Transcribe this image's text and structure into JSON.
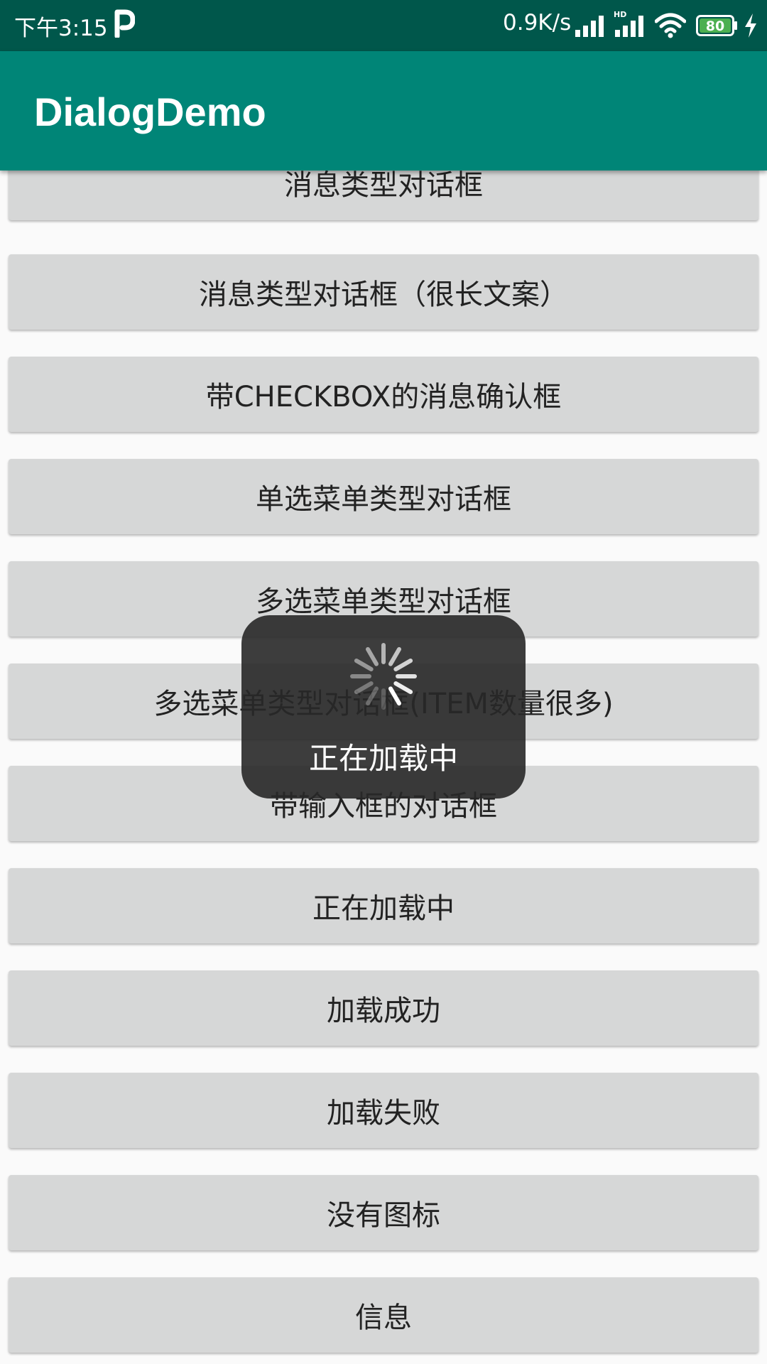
{
  "status_bar": {
    "time": "下午3:15",
    "network_speed": "0.9K/s",
    "battery_level": "80",
    "colors": {
      "background": "#00574b",
      "battery_fill": "#4caf50"
    },
    "icons": [
      "parking-p-icon",
      "signal-icon",
      "hd-signal-icon",
      "wifi-icon",
      "battery-icon",
      "charging-icon"
    ]
  },
  "app_bar": {
    "title": "DialogDemo",
    "color": "#008577"
  },
  "buttons": [
    {
      "label": "消息类型对话框"
    },
    {
      "label": "消息类型对话框（很长文案）"
    },
    {
      "label": "带CHECKBOX的消息确认框"
    },
    {
      "label": "单选菜单类型对话框"
    },
    {
      "label": "多选菜单类型对话框"
    },
    {
      "label": "多选菜单类型对话框(ITEM数量很多)"
    },
    {
      "label": "带输入框的对话框"
    },
    {
      "label": "正在加载中"
    },
    {
      "label": "加载成功"
    },
    {
      "label": "加载失败"
    },
    {
      "label": "没有图标"
    },
    {
      "label": "信息"
    }
  ],
  "loading_toast": {
    "text": "正在加载中",
    "icon": "loading-spinner-icon"
  }
}
